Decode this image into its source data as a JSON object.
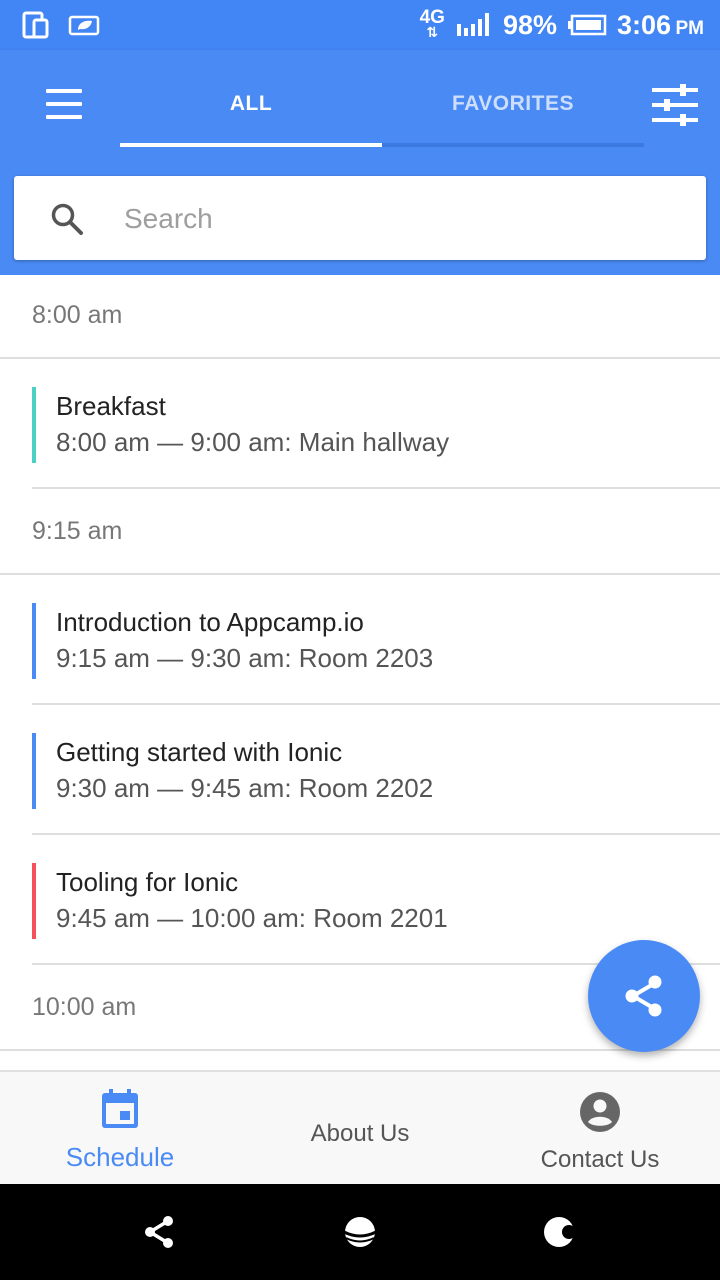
{
  "status_bar": {
    "network": "4G",
    "battery": "98%",
    "time": "3:06",
    "ampm": "PM"
  },
  "header": {
    "tabs": [
      {
        "label": "ALL",
        "selected": true
      },
      {
        "label": "FAVORITES",
        "selected": false
      }
    ],
    "search": {
      "placeholder": "Search",
      "value": ""
    }
  },
  "schedule": {
    "groups": [
      {
        "time": "8:00 am",
        "sessions": [
          {
            "title": "Breakfast",
            "details": "8:00 am — 9:00 am: Main hallway",
            "track_color": "#4dd0c4"
          }
        ]
      },
      {
        "time": "9:15 am",
        "sessions": [
          {
            "title": "Introduction to Appcamp.io",
            "details": "9:15 am — 9:30 am: Room 2203",
            "track_color": "#4a8af4"
          },
          {
            "title": "Getting started with Ionic",
            "details": "9:30 am — 9:45 am: Room 2202",
            "track_color": "#4a8af4"
          },
          {
            "title": "Tooling for Ionic",
            "details": "9:45 am — 10:00 am: Room 2201",
            "track_color": "#f4515c"
          }
        ]
      },
      {
        "time": "10:00 am",
        "sessions": []
      }
    ]
  },
  "bottom_tabs": [
    {
      "label": "Schedule",
      "selected": true
    },
    {
      "label": "About Us",
      "selected": false
    },
    {
      "label": "Contact Us",
      "selected": false
    }
  ],
  "colors": {
    "primary": "#4a8af4",
    "tab_active_text": "#4a8af4",
    "tab_inactive_text": "#555555"
  }
}
